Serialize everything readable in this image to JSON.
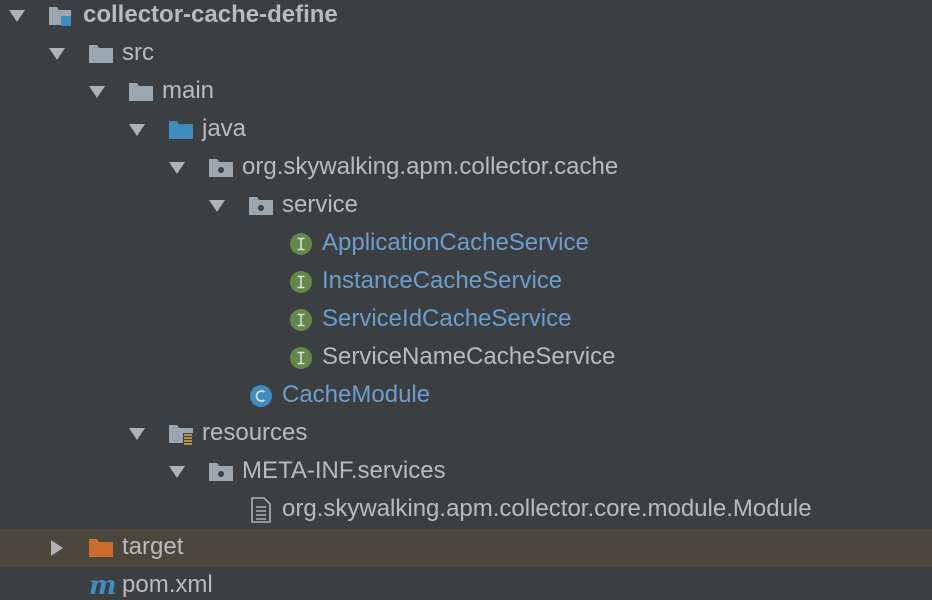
{
  "colors": {
    "background": "#3c3f41",
    "selected_row": "#4b473d",
    "text": "#bbbbbb",
    "link_text": "#6e9ece",
    "folder": "#9aa7b0",
    "source_folder": "#3d8ebf",
    "target_folder": "#cc6b2c",
    "interface_badge": "#62894a",
    "class_badge": "#3d8ebf",
    "maven_icon": "#3d8ebf"
  },
  "tree": {
    "rows": [
      {
        "label": "collector-cache-define",
        "arrow": "expanded",
        "icon": "module-folder-icon",
        "bold": true
      },
      {
        "label": "src",
        "arrow": "expanded",
        "icon": "folder-icon"
      },
      {
        "label": "main",
        "arrow": "expanded",
        "icon": "folder-icon"
      },
      {
        "label": "java",
        "arrow": "expanded",
        "icon": "source-folder-icon"
      },
      {
        "label": "org.skywalking.apm.collector.cache",
        "arrow": "expanded",
        "icon": "package-icon"
      },
      {
        "label": "service",
        "arrow": "expanded",
        "icon": "package-icon"
      },
      {
        "label": "ApplicationCacheService",
        "arrow": "none",
        "icon": "interface-icon",
        "link": true
      },
      {
        "label": "InstanceCacheService",
        "arrow": "none",
        "icon": "interface-icon",
        "link": true
      },
      {
        "label": "ServiceIdCacheService",
        "arrow": "none",
        "icon": "interface-icon",
        "link": true
      },
      {
        "label": "ServiceNameCacheService",
        "arrow": "none",
        "icon": "interface-icon"
      },
      {
        "label": "CacheModule",
        "arrow": "none",
        "icon": "class-icon",
        "link": true
      },
      {
        "label": "resources",
        "arrow": "expanded",
        "icon": "resources-folder-icon"
      },
      {
        "label": "META-INF.services",
        "arrow": "expanded",
        "icon": "package-icon"
      },
      {
        "label": "org.skywalking.apm.collector.core.module.Module",
        "arrow": "none",
        "icon": "text-file-icon"
      },
      {
        "label": "target",
        "arrow": "collapsed",
        "icon": "excluded-folder-icon",
        "selected": true
      },
      {
        "label": "pom.xml",
        "arrow": "none",
        "icon": "maven-icon"
      }
    ]
  }
}
